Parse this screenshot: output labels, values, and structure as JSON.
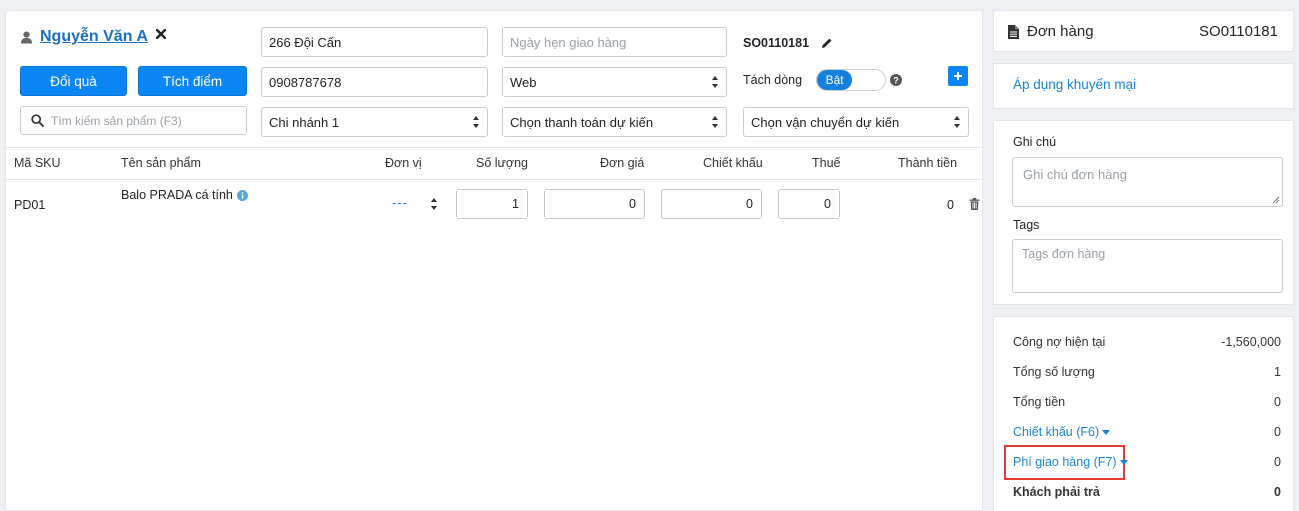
{
  "customer": {
    "name": "Nguyễn Văn A"
  },
  "buttons": {
    "redeem": "Đổi quà",
    "points": "Tích điểm"
  },
  "search": {
    "placeholder": "Tìm kiếm sản phẩm (F3)"
  },
  "fields": {
    "address": "266 Đội Cấn",
    "phone": "0908787678",
    "branch": "Chi nhánh 1",
    "delivery_date_placeholder": "Ngày hẹn giao hàng",
    "source": "Web",
    "payment": "Chọn thanh toán dự kiến",
    "shipping": "Chọn vận chuyển dự kiến"
  },
  "order": {
    "code": "SO0110181",
    "split_lines_label": "Tách dòng",
    "toggle_label": "Bật"
  },
  "table": {
    "headers": {
      "sku": "Mã SKU",
      "name": "Tên sản phẩm",
      "unit": "Đơn vị",
      "qty": "Số lượng",
      "price": "Đơn giá",
      "discount": "Chiết khấu",
      "tax": "Thuế",
      "total": "Thành tiền"
    },
    "rows": [
      {
        "sku": "PD01",
        "name": "Balo PRADA cá tính",
        "unit": "---",
        "qty": "1",
        "price": "0",
        "discount": "0",
        "tax": "0",
        "total": "0"
      }
    ]
  },
  "sidebar": {
    "order_title": "Đơn hàng",
    "order_code": "SO0110181",
    "promo_link": "Áp dụng khuyến mại",
    "note_label": "Ghi chú",
    "note_placeholder": "Ghi chú đơn hàng",
    "tags_label": "Tags",
    "tags_placeholder": "Tags đơn hàng",
    "summary": {
      "debt_label": "Công nợ hiện tại",
      "debt_value": "-1,560,000",
      "qty_label": "Tổng số lượng",
      "qty_value": "1",
      "total_label": "Tổng tiền",
      "total_value": "0",
      "discount_label": "Chiết khấu (F6)",
      "discount_value": "0",
      "shipping_label": "Phí giao hàng (F7)",
      "shipping_value": "0",
      "payable_label": "Khách phải trả",
      "payable_value": "0"
    }
  },
  "colors": {
    "accent": "#0b86f2",
    "highlight_border": "#e53935",
    "link": "#1a86d6"
  }
}
